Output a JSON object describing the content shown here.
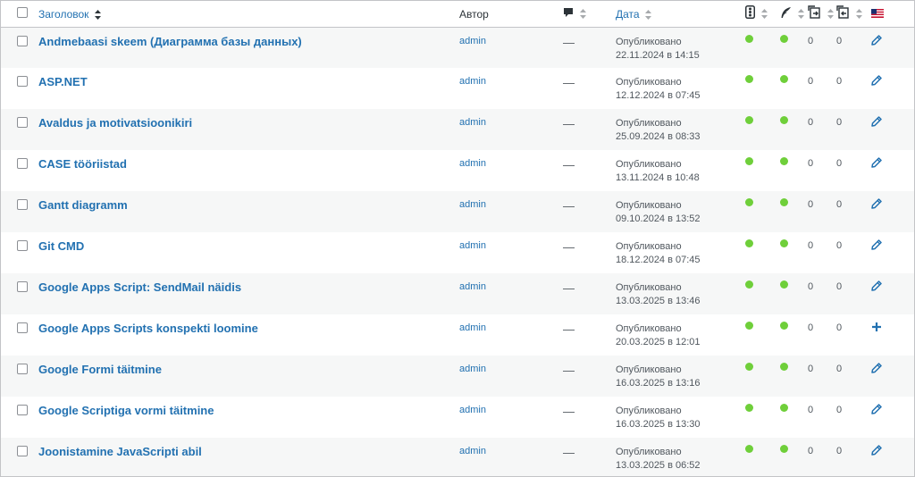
{
  "columns": {
    "title": "Заголовок",
    "author": "Автор",
    "date": "Дата"
  },
  "icons": {
    "comments": "comment-bubble-icon",
    "status1": "traffic-light-icon",
    "status2": "feather-icon",
    "links_in": "outgoing-links-icon",
    "links_out": "incoming-links-icon",
    "language": "us-flag-icon",
    "edit": "pencil-icon",
    "add": "plus-icon"
  },
  "colors": {
    "link": "#2271b1",
    "status_dot": "#6fcf3a"
  },
  "rows": [
    {
      "title": "Andmebaasi skeem (Диаграмма базы данных)",
      "author": "admin",
      "comments": "—",
      "status": "Опубликовано",
      "datetime": "22.11.2024 в 14:15",
      "c1": "0",
      "c2": "0",
      "action": "edit"
    },
    {
      "title": "ASP.NET",
      "author": "admin",
      "comments": "—",
      "status": "Опубликовано",
      "datetime": "12.12.2024 в 07:45",
      "c1": "0",
      "c2": "0",
      "action": "edit"
    },
    {
      "title": "Avaldus ja motivatsioonikiri",
      "author": "admin",
      "comments": "—",
      "status": "Опубликовано",
      "datetime": "25.09.2024 в 08:33",
      "c1": "0",
      "c2": "0",
      "action": "edit"
    },
    {
      "title": "CASE tööriistad",
      "author": "admin",
      "comments": "—",
      "status": "Опубликовано",
      "datetime": "13.11.2024 в 10:48",
      "c1": "0",
      "c2": "0",
      "action": "edit"
    },
    {
      "title": "Gantt diagramm",
      "author": "admin",
      "comments": "—",
      "status": "Опубликовано",
      "datetime": "09.10.2024 в 13:52",
      "c1": "0",
      "c2": "0",
      "action": "edit"
    },
    {
      "title": "Git CMD",
      "author": "admin",
      "comments": "—",
      "status": "Опубликовано",
      "datetime": "18.12.2024 в 07:45",
      "c1": "0",
      "c2": "0",
      "action": "edit"
    },
    {
      "title": "Google Apps Script: SendMail näidis",
      "author": "admin",
      "comments": "—",
      "status": "Опубликовано",
      "datetime": "13.03.2025 в 13:46",
      "c1": "0",
      "c2": "0",
      "action": "edit"
    },
    {
      "title": "Google Apps Scripts konspekti loomine",
      "author": "admin",
      "comments": "—",
      "status": "Опубликовано",
      "datetime": "20.03.2025 в 12:01",
      "c1": "0",
      "c2": "0",
      "action": "add"
    },
    {
      "title": "Google Formi täitmine",
      "author": "admin",
      "comments": "—",
      "status": "Опубликовано",
      "datetime": "16.03.2025 в 13:16",
      "c1": "0",
      "c2": "0",
      "action": "edit"
    },
    {
      "title": "Google Scriptiga vormi täitmine",
      "author": "admin",
      "comments": "—",
      "status": "Опубликовано",
      "datetime": "16.03.2025 в 13:30",
      "c1": "0",
      "c2": "0",
      "action": "edit"
    },
    {
      "title": "Joonistamine JavaScripti abil",
      "author": "admin",
      "comments": "—",
      "status": "Опубликовано",
      "datetime": "13.03.2025 в 06:52",
      "c1": "0",
      "c2": "0",
      "action": "edit"
    }
  ]
}
